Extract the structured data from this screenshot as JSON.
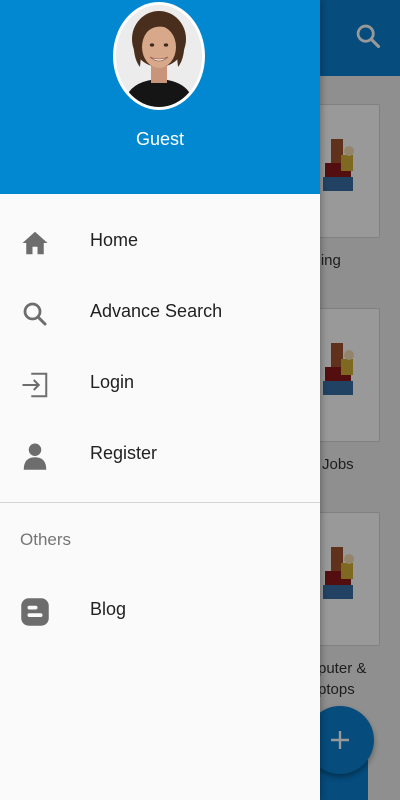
{
  "drawer": {
    "user_name": "Guest",
    "menu": [
      {
        "label": "Home",
        "icon": "home-icon"
      },
      {
        "label": "Advance Search",
        "icon": "search-icon"
      },
      {
        "label": "Login",
        "icon": "login-icon"
      },
      {
        "label": "Register",
        "icon": "person-icon"
      }
    ],
    "section_title": "Others",
    "others": [
      {
        "label": "Blog",
        "icon": "blogger-icon"
      }
    ]
  },
  "background": {
    "cards": [
      {
        "label": "othing"
      },
      {
        "label": "Jobs"
      },
      {
        "label_line1": "puter &",
        "label_line2": "ptops"
      }
    ]
  },
  "colors": {
    "primary": "#0288d1",
    "appbar": "#0a7fd0",
    "icon_gray": "#6d6d6d"
  }
}
